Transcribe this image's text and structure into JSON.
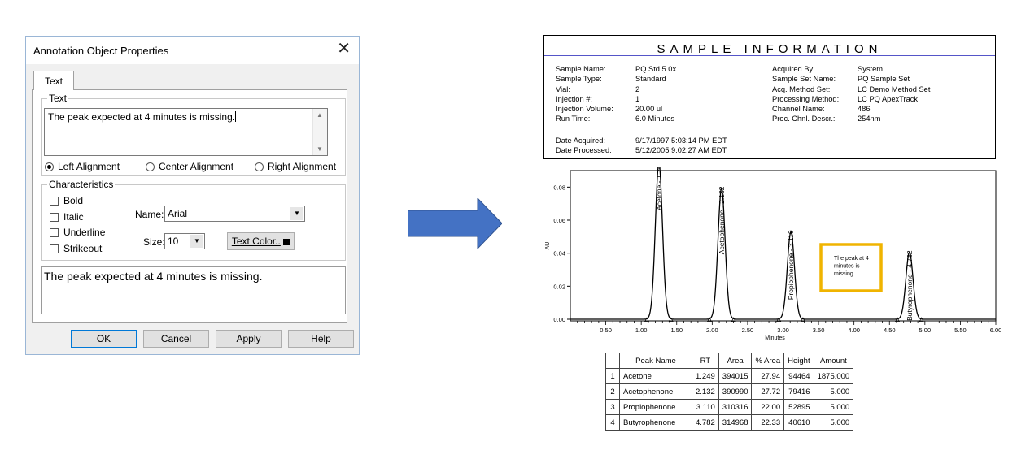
{
  "dialog": {
    "title": "Annotation Object Properties",
    "close_glyph": "✕",
    "tab_label": "Text",
    "text_group_label": "Text",
    "text_value": "The peak expected at 4 minutes is missing.",
    "alignment": {
      "left": "Left Alignment",
      "center": "Center Alignment",
      "right": "Right Alignment"
    },
    "characteristics_label": "Characteristics",
    "bold": "Bold",
    "italic": "Italic",
    "underline": "Underline",
    "strikeout": "Strikeout",
    "name_label": "Name:",
    "font_name": "Arial",
    "size_label": "Size:",
    "font_size": "10",
    "text_color_label": "Text Color..",
    "preview_text": "The peak expected at 4 minutes is missing.",
    "buttons": {
      "ok": "OK",
      "cancel": "Cancel",
      "apply": "Apply",
      "help": "Help"
    },
    "accent_color": "#0078d7"
  },
  "report": {
    "title": "SAMPLE  INFORMATION",
    "left_labels": [
      "Sample Name:",
      "Sample Type:",
      "Vial:",
      "Injection #:",
      "Injection Volume:",
      "Run Time:"
    ],
    "left_values": [
      "PQ Std 5.0x",
      "Standard",
      "2",
      "1",
      "20.00 ul",
      "6.0 Minutes"
    ],
    "right_labels": [
      "Acquired By:",
      "Sample Set Name:",
      "Acq. Method Set:",
      "Processing Method:",
      "Channel Name:",
      "Proc. Chnl. Descr.:"
    ],
    "right_values": [
      "System",
      "PQ Sample Set",
      "LC Demo Method Set",
      "LC PQ ApexTrack",
      "486",
      "254nm"
    ],
    "date_labels": [
      "Date Acquired:",
      "Date Processed:"
    ],
    "date_values": [
      "9/17/1997 5:03:14 PM EDT",
      "5/12/2005 9:02:27 AM EDT"
    ]
  },
  "chart_data": {
    "type": "line",
    "title": "",
    "xlabel": "Minutes",
    "ylabel": "AU",
    "xlim": [
      0.0,
      6.0
    ],
    "ylim": [
      0.0,
      0.09
    ],
    "x_ticks": [
      "0.50",
      "1.00",
      "1.50",
      "2.00",
      "2.50",
      "3.00",
      "3.50",
      "4.00",
      "4.50",
      "5.00",
      "5.50",
      "6.00"
    ],
    "y_ticks": [
      "0.00",
      "0.02",
      "0.04",
      "0.06",
      "0.08"
    ],
    "grid": false,
    "series_color": "#000000",
    "peaks": [
      {
        "label": "Acetone - 1.249",
        "rt": 1.249,
        "height": 0.0945
      },
      {
        "label": "Acetophenone - 2.132",
        "rt": 2.132,
        "height": 0.0794
      },
      {
        "label": "Propiophenone - 3.110",
        "rt": 3.11,
        "height": 0.0529
      },
      {
        "label": "Butyrophenone - 4.782",
        "rt": 4.782,
        "height": 0.0406
      }
    ],
    "annotation": {
      "text": "The peak at 4 minutes is missing.",
      "border_color": "#f0b400"
    }
  },
  "peak_table": {
    "headers": [
      "",
      "Peak Name",
      "RT",
      "Area",
      "% Area",
      "Height",
      "Amount"
    ],
    "rows": [
      [
        "1",
        "Acetone",
        "1.249",
        "394015",
        "27.94",
        "94464",
        "1875.000"
      ],
      [
        "2",
        "Acetophenone",
        "2.132",
        "390990",
        "27.72",
        "79416",
        "5.000"
      ],
      [
        "3",
        "Propiophenone",
        "3.110",
        "310316",
        "22.00",
        "52895",
        "5.000"
      ],
      [
        "4",
        "Butyrophenone",
        "4.782",
        "314968",
        "22.33",
        "40610",
        "5.000"
      ]
    ]
  }
}
